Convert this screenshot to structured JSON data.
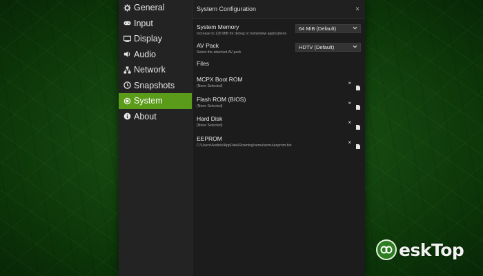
{
  "sidebar": {
    "items": [
      {
        "label": "General",
        "icon": "gear-icon"
      },
      {
        "label": "Input",
        "icon": "gamepad-icon"
      },
      {
        "label": "Display",
        "icon": "monitor-icon"
      },
      {
        "label": "Audio",
        "icon": "speaker-icon"
      },
      {
        "label": "Network",
        "icon": "network-icon"
      },
      {
        "label": "Snapshots",
        "icon": "clock-icon"
      },
      {
        "label": "System",
        "icon": "chip-icon",
        "active": true
      },
      {
        "label": "About",
        "icon": "info-icon"
      }
    ]
  },
  "panel": {
    "title": "System Configuration",
    "close": "×"
  },
  "settings": {
    "memory": {
      "label": "System Memory",
      "description": "Increase to 128 MiB for debug or homebrew applications",
      "value": "64 MiB (Default)"
    },
    "av_pack": {
      "label": "AV Pack",
      "description": "Select the attached AV pack",
      "value": "HDTV (Default)"
    }
  },
  "files": {
    "title": "Files",
    "rows": [
      {
        "label": "MCPX Boot ROM",
        "path": "(None Selected)"
      },
      {
        "label": "Flash ROM (BIOS)",
        "path": "(None Selected)"
      },
      {
        "label": "Hard Disk",
        "path": "(None Selected)"
      },
      {
        "label": "EEPROM",
        "path": "C:\\Users\\Andrés\\AppData\\Roaming\\xemu\\xemu\\eeprom.bin"
      }
    ],
    "clear_glyph": "×"
  },
  "watermark": {
    "text": "eskTop"
  },
  "colors": {
    "accent": "#5a9b1a",
    "background": "#164a10"
  }
}
